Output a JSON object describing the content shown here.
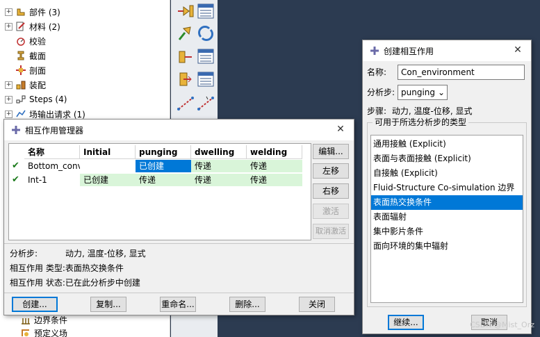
{
  "model_tree": {
    "items": [
      {
        "label": "部件 (3)",
        "expandable": true
      },
      {
        "label": "材料 (2)",
        "expandable": true
      },
      {
        "label": "校验",
        "expandable": false
      },
      {
        "label": "截面",
        "expandable": false
      },
      {
        "label": "剖面",
        "expandable": false
      },
      {
        "label": "装配",
        "expandable": true
      },
      {
        "label": "Steps (4)",
        "expandable": true
      },
      {
        "label": "场输出请求 (1)",
        "expandable": true
      }
    ],
    "bottom_items": [
      {
        "label": "边界条件"
      },
      {
        "label": "预定义场"
      }
    ]
  },
  "manager": {
    "title": "相互作用管理器",
    "columns": [
      "名称",
      "Initial",
      "punging",
      "dwelling",
      "welding"
    ],
    "rows": [
      {
        "name": "Bottom_conv",
        "cells": [
          "",
          "已创建",
          "传递",
          "传递"
        ]
      },
      {
        "name": "Int-1",
        "cells": [
          "已创建",
          "传递",
          "传递",
          "传递"
        ]
      }
    ],
    "side_buttons": [
      "编辑...",
      "左移",
      "右移",
      "激活",
      "取消激活"
    ],
    "info": {
      "step_label": "分析步:",
      "step_value": "动力, 温度-位移, 显式",
      "type_label": "相互作用 类型:",
      "type_value": "表面热交换条件",
      "status_label": "相互作用 状态:",
      "status_value": "已在此分析步中创建"
    },
    "bottom_buttons": [
      "创建...",
      "复制...",
      "重命名...",
      "删除...",
      "关闭"
    ]
  },
  "create": {
    "title": "创建相互作用",
    "name_label": "名称:",
    "name_value": "Con_environment",
    "step_label": "分析步:",
    "step_value": "punging",
    "procedure_label": "步骤:",
    "procedure_value": "动力, 温度-位移, 显式",
    "group_label": "可用于所选分析步的类型",
    "types": [
      "通用接触 (Explicit)",
      "表面与表面接触 (Explicit)",
      "自接触 (Explicit)",
      "Fluid-Structure Co-simulation 边界",
      "表面热交换条件",
      "表面辐射",
      "集中影片条件",
      "面向环境的集中辐射"
    ],
    "selected_index": 4,
    "continue_label": "继续...",
    "cancel_label": "取消"
  },
  "watermark": "CSDN @Mist_Orz",
  "colors": {
    "selection": "#0078d7",
    "created_row": "#d9f5d9",
    "viewport": "#2c3b51"
  }
}
